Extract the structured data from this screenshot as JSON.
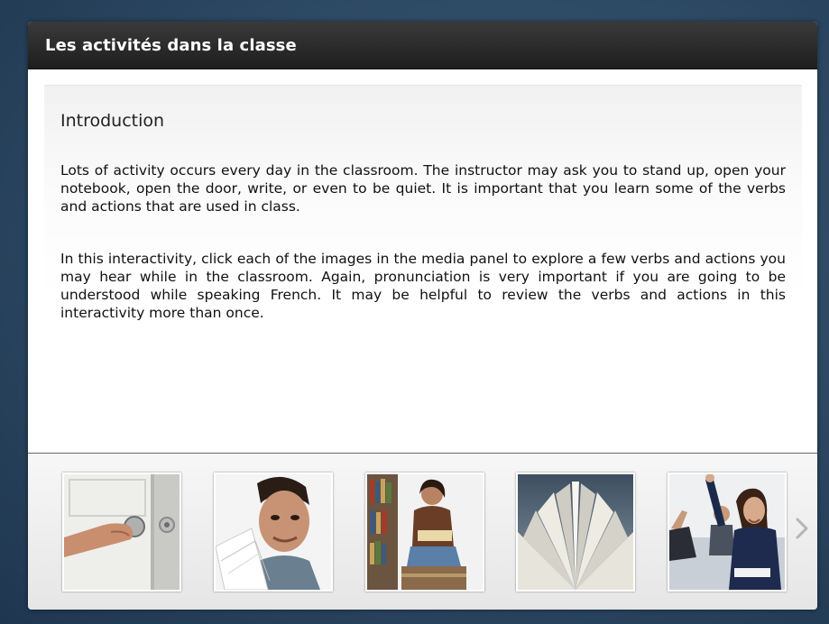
{
  "window": {
    "title": "Les activités dans la classe"
  },
  "content": {
    "heading": "Introduction",
    "paragraphs": [
      "Lots of activity occurs every day in the classroom. The instructor may ask you to stand up, open your notebook, open the door, write, or even to be quiet. It is important that you learn some of the verbs and actions that are used in class.",
      "In this interactivity, click each of the images in the media panel to explore a few verbs and actions you may hear while in the classroom. Again, pronunciation is very important if you are going to be understood while speaking French. It may be helpful to review the verbs and actions in this interactivity more than once."
    ]
  },
  "media_panel": {
    "thumbnails": [
      {
        "icon": "door-handle-image"
      },
      {
        "icon": "student-papers-image"
      },
      {
        "icon": "reading-library-image"
      },
      {
        "icon": "open-book-image"
      },
      {
        "icon": "raised-hand-image"
      }
    ],
    "next_icon": "chevron-right-icon"
  },
  "colors": {
    "titlebar": "#2a2a2a",
    "background": "#2c4862",
    "panel": "#ffffff"
  }
}
